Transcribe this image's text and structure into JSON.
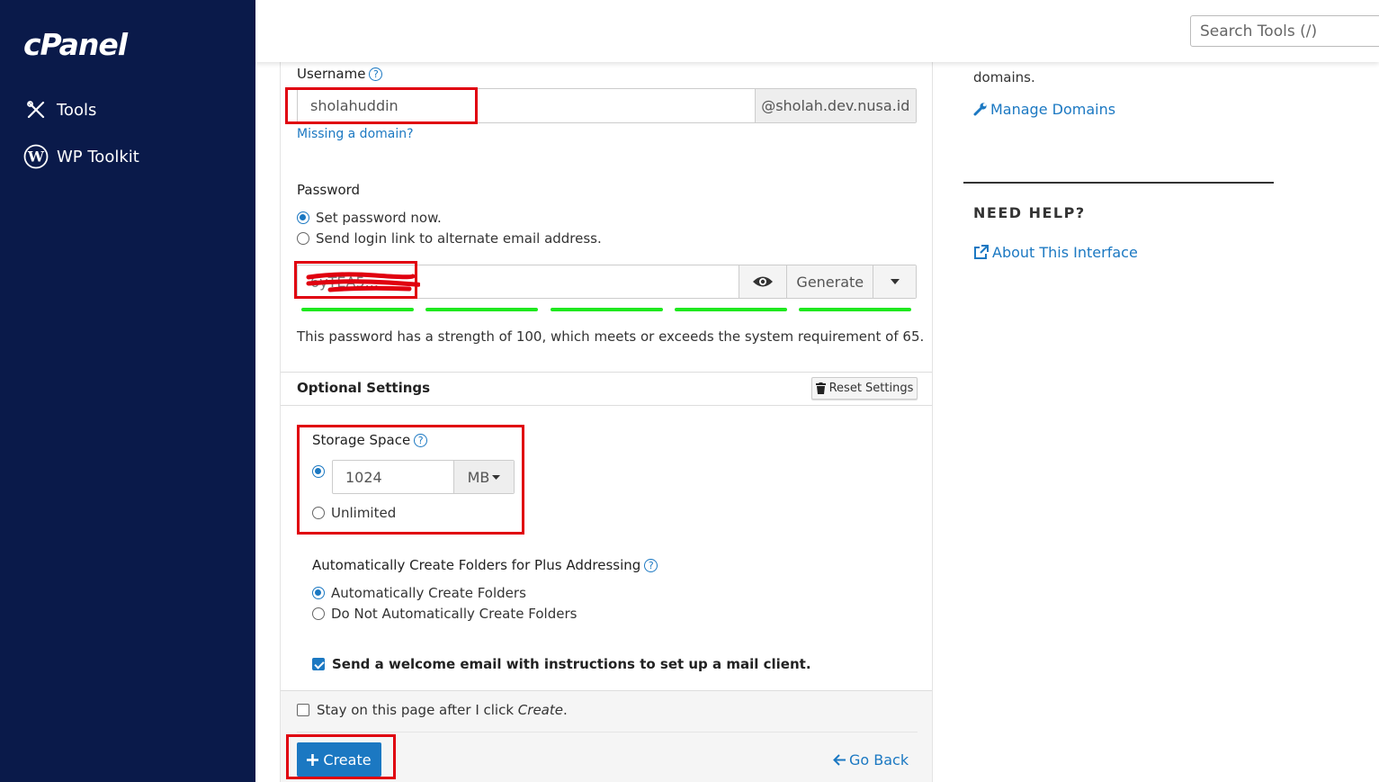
{
  "sidebar": {
    "logo": "cPanel",
    "items": [
      {
        "label": "Tools",
        "icon": "tools-icon"
      },
      {
        "label": "WP Toolkit",
        "icon": "wordpress-icon"
      }
    ]
  },
  "header": {
    "search_placeholder": "Search Tools (/)"
  },
  "form": {
    "username_label": "Username",
    "username_value": "sholahuddin",
    "domain_suffix": "@sholah.dev.nusa.id",
    "missing_domain_link": "Missing a domain?",
    "password_label": "Password",
    "password_options": [
      "Set password now.",
      "Send login link to alternate email address."
    ],
    "password_value": "6yTEA5...",
    "generate_label": "Generate",
    "strength_text": "This password has a strength of 100, which meets or exceeds the system requirement of 65.",
    "strength_value": 100,
    "optional_settings_label": "Optional Settings",
    "reset_settings_label": "Reset Settings",
    "storage_label": "Storage Space",
    "storage_value": "1024",
    "storage_unit": "MB",
    "storage_unlimited_label": "Unlimited",
    "plus_addressing_label": "Automatically Create Folders for Plus Addressing",
    "plus_options": [
      "Automatically Create Folders",
      "Do Not Automatically Create Folders"
    ],
    "welcome_email_label": "Send a welcome email with instructions to set up a mail client.",
    "stay_on_page_prefix": "Stay on this page after I click ",
    "stay_on_page_em": "Create",
    "stay_on_page_suffix": ".",
    "create_label": "Create",
    "go_back_label": "Go Back"
  },
  "help": {
    "partial_text": "domains.",
    "manage_domains_link": "Manage Domains",
    "need_help_title": "NEED HELP?",
    "about_link": "About This Interface"
  },
  "colors": {
    "sidebar": "#0a1a4a",
    "accent": "#1b78c2",
    "strength": "#1ee81e",
    "highlight": "#e0000f"
  }
}
